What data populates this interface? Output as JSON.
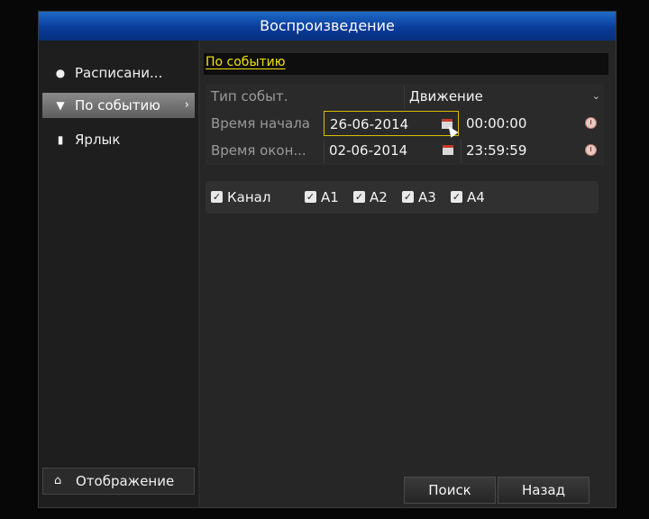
{
  "window": {
    "title": "Воспроизведение"
  },
  "sidebar": {
    "items": [
      {
        "label": "Расписани...",
        "icon": "play-circle-icon"
      },
      {
        "label": "По событию",
        "icon": "event-pin-icon",
        "arrow": "›"
      },
      {
        "label": "Ярлык",
        "icon": "bookmark-icon"
      }
    ],
    "display": {
      "label": "Отображение",
      "icon": "home-icon"
    }
  },
  "main": {
    "tab": "По событию",
    "event_type": {
      "label": "Тип событ.",
      "value": "Движение",
      "arrow": "⌄"
    },
    "start": {
      "label": "Время начала",
      "date": "26-06-2014",
      "time": "00:00:00"
    },
    "end": {
      "label": "Время окон...",
      "date": "02-06-2014",
      "time": "23:59:59"
    },
    "channels": {
      "all": {
        "label": "Канал",
        "checked": true
      },
      "items": [
        {
          "label": "A1",
          "checked": true
        },
        {
          "label": "A2",
          "checked": true
        },
        {
          "label": "A3",
          "checked": true
        },
        {
          "label": "A4",
          "checked": true
        }
      ]
    }
  },
  "buttons": {
    "search": "Поиск",
    "back": "Назад"
  },
  "colors": {
    "title_bar": "#0a3c9a",
    "tab_highlight": "#f2e300",
    "focus_border": "#d9c000"
  }
}
